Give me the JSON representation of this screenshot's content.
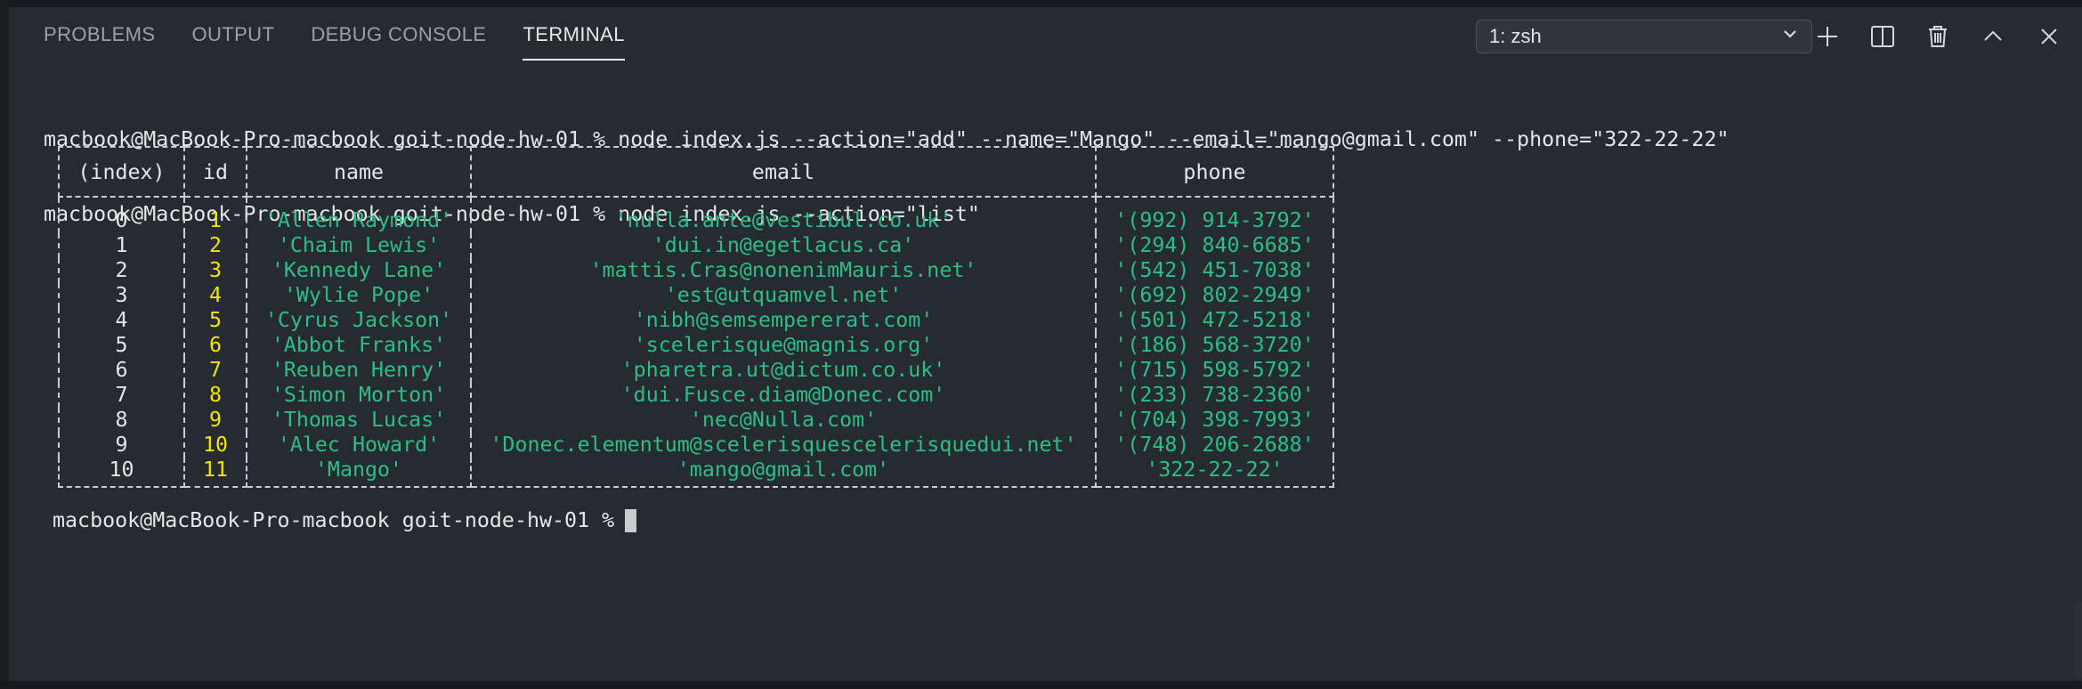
{
  "panel": {
    "tabs": [
      {
        "label": "PROBLEMS",
        "active": false
      },
      {
        "label": "OUTPUT",
        "active": false
      },
      {
        "label": "DEBUG CONSOLE",
        "active": false
      },
      {
        "label": "TERMINAL",
        "active": true
      }
    ],
    "terminal_select": "1: zsh",
    "icons": [
      "plus-icon",
      "split-icon",
      "trash-icon",
      "chevron-up-icon",
      "close-icon"
    ]
  },
  "terminal": {
    "lines": [
      "macbook@MacBook-Pro-macbook goit-node-hw-01 % node index.js --action=\"add\" --name=\"Mango\" --email=\"mango@gmail.com\" --phone=\"322-22-22\"",
      "macbook@MacBook-Pro-macbook goit-node-hw-01 % node index.js --action=\"list\""
    ],
    "prompt": "macbook@MacBook-Pro-macbook goit-node-hw-01 %"
  },
  "table": {
    "headers": [
      "(index)",
      "id",
      "name",
      "email",
      "phone"
    ],
    "rows": [
      [
        "0",
        "1",
        "'Allen Raymond'",
        "'nulla.ante@vestibul.co.uk'",
        "'(992) 914-3792'"
      ],
      [
        "1",
        "2",
        "'Chaim Lewis'",
        "'dui.in@egetlacus.ca'",
        "'(294) 840-6685'"
      ],
      [
        "2",
        "3",
        "'Kennedy Lane'",
        "'mattis.Cras@nonenimMauris.net'",
        "'(542) 451-7038'"
      ],
      [
        "3",
        "4",
        "'Wylie Pope'",
        "'est@utquamvel.net'",
        "'(692) 802-2949'"
      ],
      [
        "4",
        "5",
        "'Cyrus Jackson'",
        "'nibh@semsempererat.com'",
        "'(501) 472-5218'"
      ],
      [
        "5",
        "6",
        "'Abbot Franks'",
        "'scelerisque@magnis.org'",
        "'(186) 568-3720'"
      ],
      [
        "6",
        "7",
        "'Reuben Henry'",
        "'pharetra.ut@dictum.co.uk'",
        "'(715) 598-5792'"
      ],
      [
        "7",
        "8",
        "'Simon Morton'",
        "'dui.Fusce.diam@Donec.com'",
        "'(233) 738-2360'"
      ],
      [
        "8",
        "9",
        "'Thomas Lucas'",
        "'nec@Nulla.com'",
        "'(704) 398-7993'"
      ],
      [
        "9",
        "10",
        "'Alec Howard'",
        "'Donec.elementum@scelerisquescelerisquedui.net'",
        "'(748) 206-2688'"
      ],
      [
        "10",
        "11",
        "'Mango'",
        "'mango@gmail.com'",
        "'322-22-22'"
      ]
    ]
  },
  "colors": {
    "background": "#262a31",
    "text": "#e3e6ea",
    "string": "#2bbf86",
    "number": "#f0e600"
  }
}
